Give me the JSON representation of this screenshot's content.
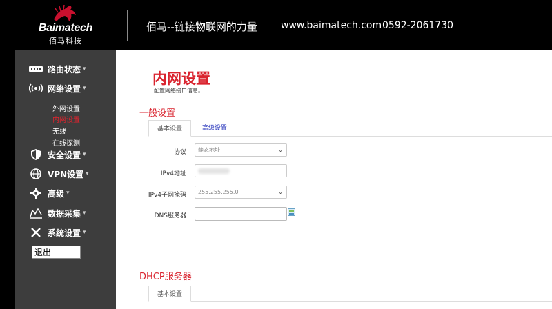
{
  "header": {
    "logo_name": "Baimatech",
    "logo_cn": "佰马科技",
    "slogan": "佰马--链接物联网的力量",
    "website": "www.baimatech.com",
    "phone": "0592-2061730"
  },
  "sidebar": {
    "items": [
      {
        "label": "路由状态",
        "icon": "router-status-icon"
      },
      {
        "label": "网络设置",
        "icon": "wifi-signal-icon"
      },
      {
        "label": "安全设置",
        "icon": "shield-icon"
      },
      {
        "label": "VPN设置",
        "icon": "globe-icon"
      },
      {
        "label": "高级",
        "icon": "gear-icon"
      },
      {
        "label": "数据采集",
        "icon": "data-collect-icon"
      },
      {
        "label": "系统设置",
        "icon": "tools-icon"
      }
    ],
    "subitems": [
      {
        "label": "外网设置",
        "active": false
      },
      {
        "label": "内网设置",
        "active": true
      },
      {
        "label": "无线",
        "active": false
      },
      {
        "label": "在线探测",
        "active": false
      }
    ],
    "caret": "▾",
    "logout": "退出"
  },
  "main": {
    "title": "内网设置",
    "description": "配置网络接口信息。",
    "general_section": "一般设置",
    "tabs": [
      {
        "label": "基本设置",
        "active": true
      },
      {
        "label": "高级设置",
        "active": false
      }
    ],
    "form": {
      "protocol_label": "协议",
      "protocol_value": "静态地址",
      "ipv4_label": "IPv4地址",
      "netmask_label": "IPv4子网掩码",
      "netmask_value": "255.255.255.0",
      "dns_label": "DNS服务器",
      "dns_value": ""
    },
    "dhcp_section": "DHCP服务器",
    "dhcp_tab": "基本设置"
  },
  "colors": {
    "accent_red": "#d9232e",
    "link_blue": "#1d2bb8",
    "sidebar_bg": "#3d3d3d",
    "header_bg": "#000000"
  }
}
